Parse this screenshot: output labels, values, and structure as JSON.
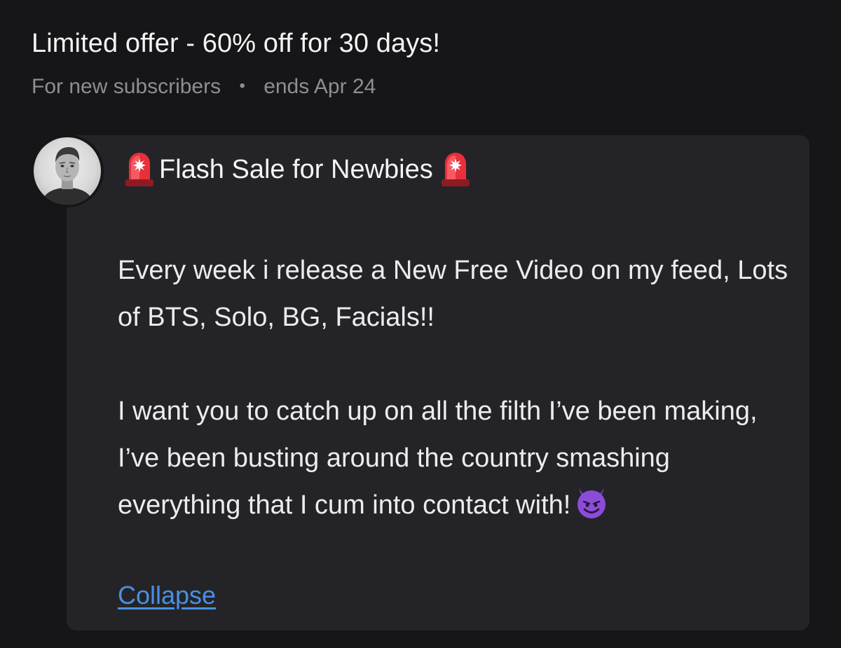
{
  "offer": {
    "title": "Limited offer - 60% off for 30 days!",
    "audience": "For new subscribers",
    "separator": "•",
    "expiry": "ends Apr 24"
  },
  "message": {
    "title_icon": "police-light-icon",
    "title": "Flash Sale for Newbies",
    "paragraph_1": "Every week i release a New Free Video on my feed, Lots of BTS, Solo, BG, Facials!!",
    "paragraph_2": "I want you to catch up on all the filth I’ve been making, I’ve been busting around the country smashing everything that I cum into contact with!",
    "emoji_icon": "smiling-devil-icon",
    "collapse_label": "Collapse"
  },
  "colors": {
    "background": "#161618",
    "card": "#242428",
    "muted_text": "#8e8e93",
    "link": "#4a90e2",
    "siren_red": "#e8303a",
    "devil_purple": "#8b4dd8"
  }
}
